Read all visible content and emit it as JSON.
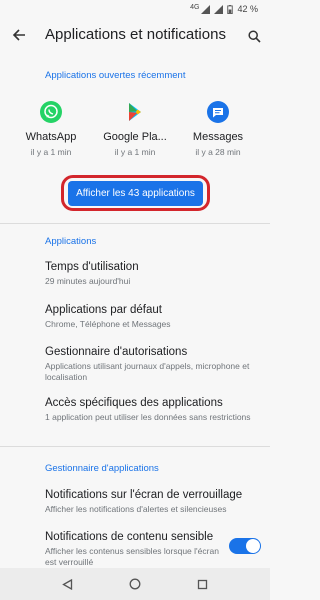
{
  "status": {
    "network": "4G",
    "battery": "42 %"
  },
  "header": {
    "title": "Applications et notifications"
  },
  "recent": {
    "section_label": "Applications ouvertes récemment",
    "apps": [
      {
        "name": "WhatsApp",
        "time": "il y a 1 min",
        "icon": "whatsapp-icon",
        "color": "#25d366"
      },
      {
        "name": "Google Pla...",
        "time": "il y a 1 min",
        "icon": "google-play-icon",
        "color": "#ffffff"
      },
      {
        "name": "Messages",
        "time": "il y a 28 min",
        "icon": "messages-icon",
        "color": "#1a73e8"
      }
    ],
    "show_all_label": "Afficher les 43 applications"
  },
  "applications": {
    "section_label": "Applications",
    "items": [
      {
        "title": "Temps d'utilisation",
        "subtitle": "29 minutes aujourd'hui"
      },
      {
        "title": "Applications par défaut",
        "subtitle": "Chrome, Téléphone et Messages"
      },
      {
        "title": "Gestionnaire d'autorisations",
        "subtitle": "Applications utilisant journaux d'appels, microphone et localisation"
      },
      {
        "title": "Accès spécifiques des applications",
        "subtitle": "1 application peut utiliser les données sans restrictions"
      }
    ]
  },
  "manager": {
    "section_label": "Gestionnaire d'applications",
    "items": [
      {
        "title": "Notifications sur l'écran de verrouillage",
        "subtitle": "Afficher les notifications d'alertes et silencieuses"
      },
      {
        "title": "Notifications de contenu sensible",
        "subtitle": "Afficher les contenus sensibles lorsque l'écran est verrouillé",
        "toggle_on": true
      }
    ]
  },
  "colors": {
    "accent": "#1a73e8",
    "highlight": "#d3262c"
  }
}
